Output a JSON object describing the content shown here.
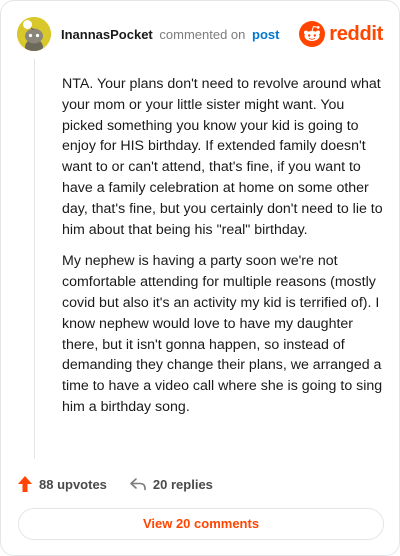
{
  "comment": {
    "author": "InannasPocket",
    "action": "commented on",
    "post_link": "post",
    "paragraphs": [
      "NTA. Your plans don't need to revolve around what your mom or your little sister might want. You picked something you know your kid is going to enjoy for HIS birthday. If extended family doesn't want to or can't attend, that's fine, if you want to have a family celebration at home on some other day, that's fine, but you certainly don't need to lie to him about that being his \"real\" birthday.",
      "My nephew is having a party soon we're not comfortable attending for multiple reasons (mostly covid but also it's an activity my kid is terrified of). I know nephew would love to have my daughter there, but it isn't gonna happen, so instead of demanding they change their plans, we arranged a time to have a video call where she is going to sing him a birthday song."
    ]
  },
  "brand": {
    "name": "reddit",
    "icon": "reddit-snoo-icon",
    "color": "#ff4500"
  },
  "footer": {
    "upvotes": "88 upvotes",
    "replies": "20 replies",
    "view_comments": "View 20 comments"
  },
  "colors": {
    "accent": "#ff4500",
    "link": "#0079d3",
    "avatar_bg": "#d9c82c"
  }
}
